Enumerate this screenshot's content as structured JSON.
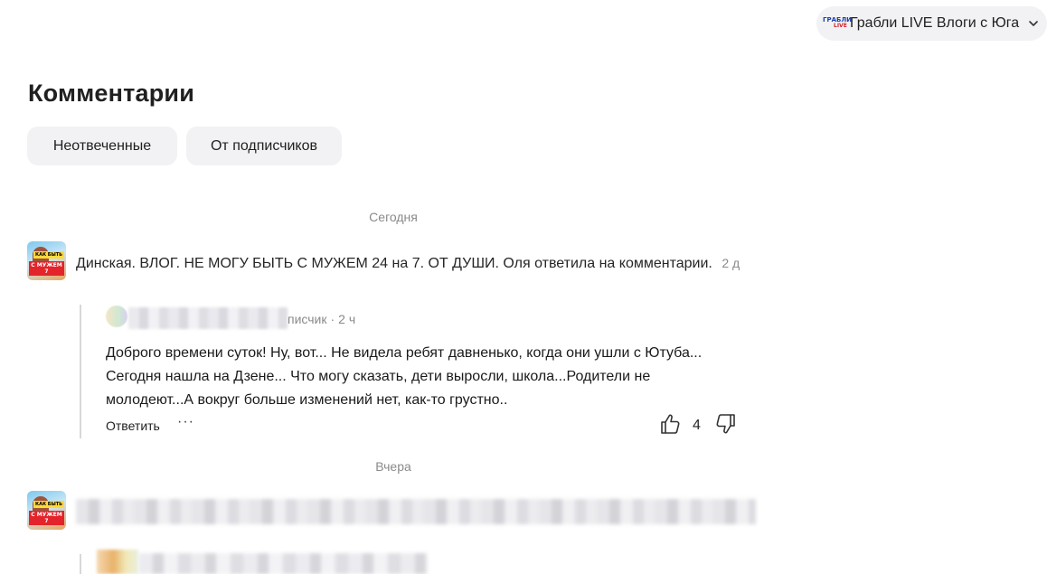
{
  "channel": {
    "logo_text_top": "ГРАБЛИ",
    "logo_text_bottom": "LIVE",
    "name": "Грабли LIVE Влоги с Юга"
  },
  "page_title": "Комментарии",
  "filters": [
    {
      "label": "Неотвеченные"
    },
    {
      "label": "От подписчиков"
    }
  ],
  "groups": [
    {
      "date_label": "Сегодня",
      "video": {
        "thumb_tag_top": "КАК БЫТЬ",
        "thumb_tag_bottom": "С МУЖЕМ 7",
        "title": "Динская. ВЛОГ. НЕ МОГУ БЫТЬ С МУЖЕМ 24 на 7. ОТ ДУШИ. Оля ответила на комментарии.",
        "ago": "2 д"
      },
      "comment": {
        "author_visible_tail": "писчик",
        "dot": "·",
        "ago": "2 ч",
        "text": "Доброго времени суток! Ну, вот... Не видела ребят давненько, когда они ушли с Ютуба... Сегодня нашла на Дзене... Что могу сказать, дети выросли, школа...Родители не молодеют...А вокруг больше изменений нет, как-то грустно..",
        "reply_label": "Ответить",
        "more_label": "···",
        "likes": "4"
      }
    },
    {
      "date_label": "Вчера",
      "video": {
        "thumb_tag_top": "КАК БЫТЬ",
        "thumb_tag_bottom": "С МУЖЕМ 7"
      }
    }
  ],
  "colors": {
    "pill_bg": "#f2f2f4",
    "muted_text": "#8a8a8a",
    "thread_bar": "#d8d8d8"
  },
  "icons": {
    "chevron": "chevron-down-icon",
    "like": "thumb-up-icon",
    "dislike": "thumb-down-icon"
  }
}
